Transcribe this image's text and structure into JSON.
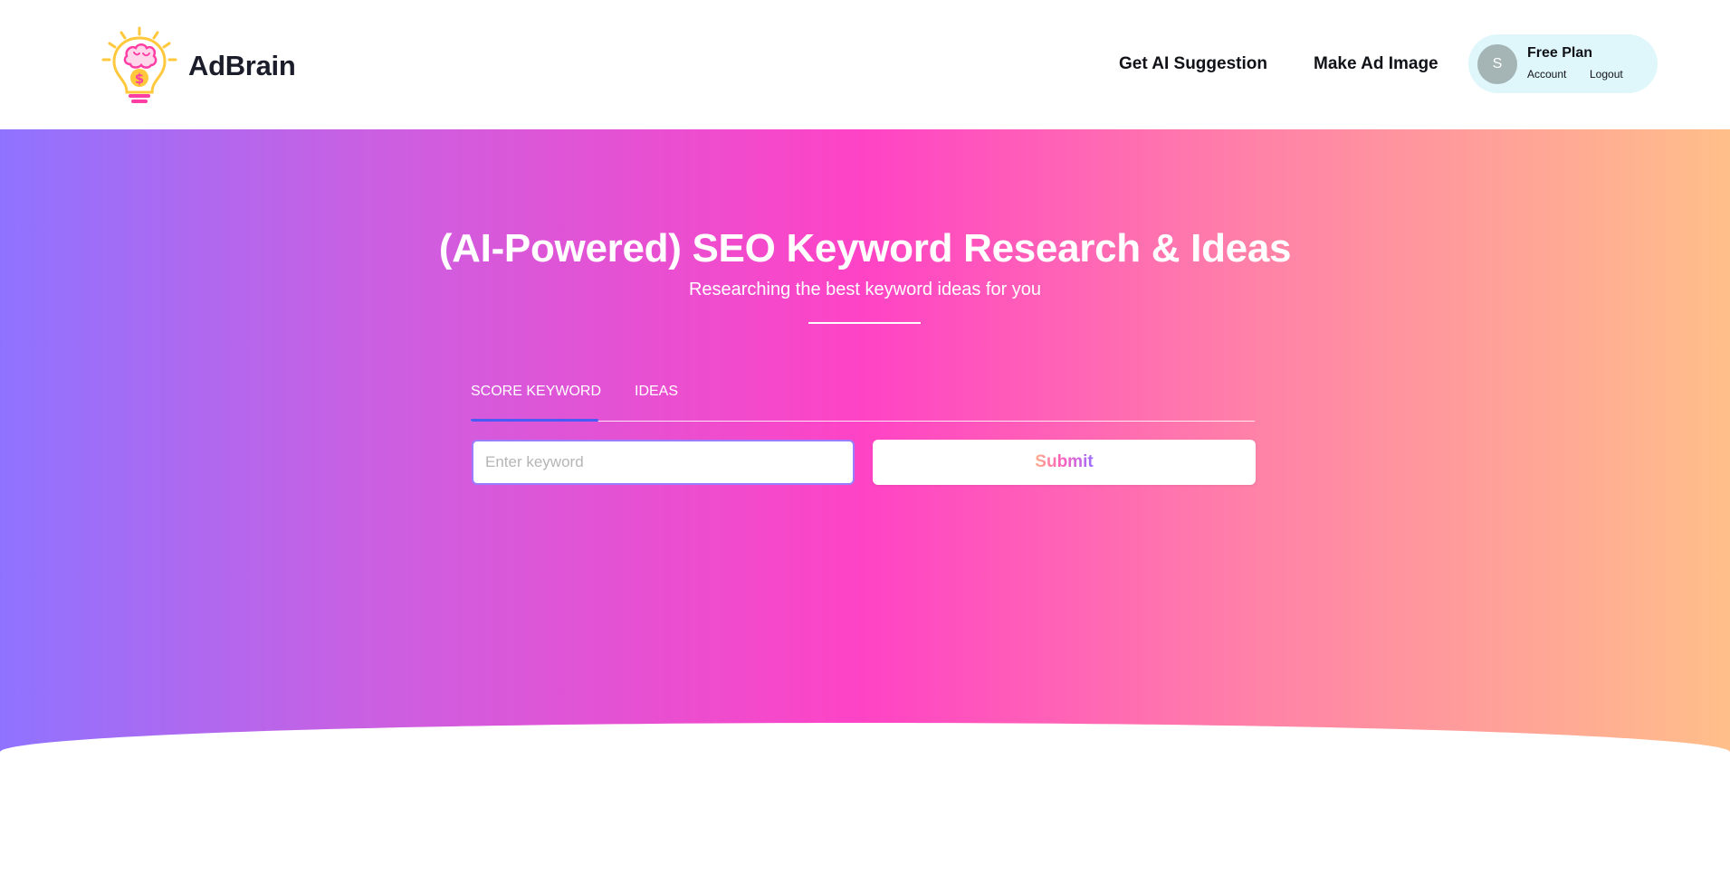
{
  "header": {
    "brand": "AdBrain",
    "nav": {
      "ai_suggestion": "Get AI Suggestion",
      "ad_image": "Make Ad Image"
    },
    "account": {
      "avatar_initial": "S",
      "plan": "Free Plan",
      "account_link": "Account",
      "logout_link": "Logout"
    }
  },
  "hero": {
    "title": "(AI-Powered) SEO Keyword Research & Ideas",
    "subtitle": "Researching the best keyword ideas for you",
    "tabs": [
      {
        "label": "SCORE KEYWORD",
        "active": true
      },
      {
        "label": "IDEAS",
        "active": false
      }
    ],
    "form": {
      "keyword_value": "",
      "keyword_placeholder": "Enter keyword",
      "submit_label": "Submit"
    }
  },
  "colors": {
    "gradient_start": "#8f73ff",
    "gradient_mid": "#ff43c5",
    "gradient_end": "#ffbf8a",
    "tab_active_underline": "#4a5bf5",
    "plan_box_bg": "#dff7fb",
    "avatar_bg": "#a5b5b5"
  },
  "icons": {
    "logo": "lightbulb-brain-dollar-icon"
  }
}
